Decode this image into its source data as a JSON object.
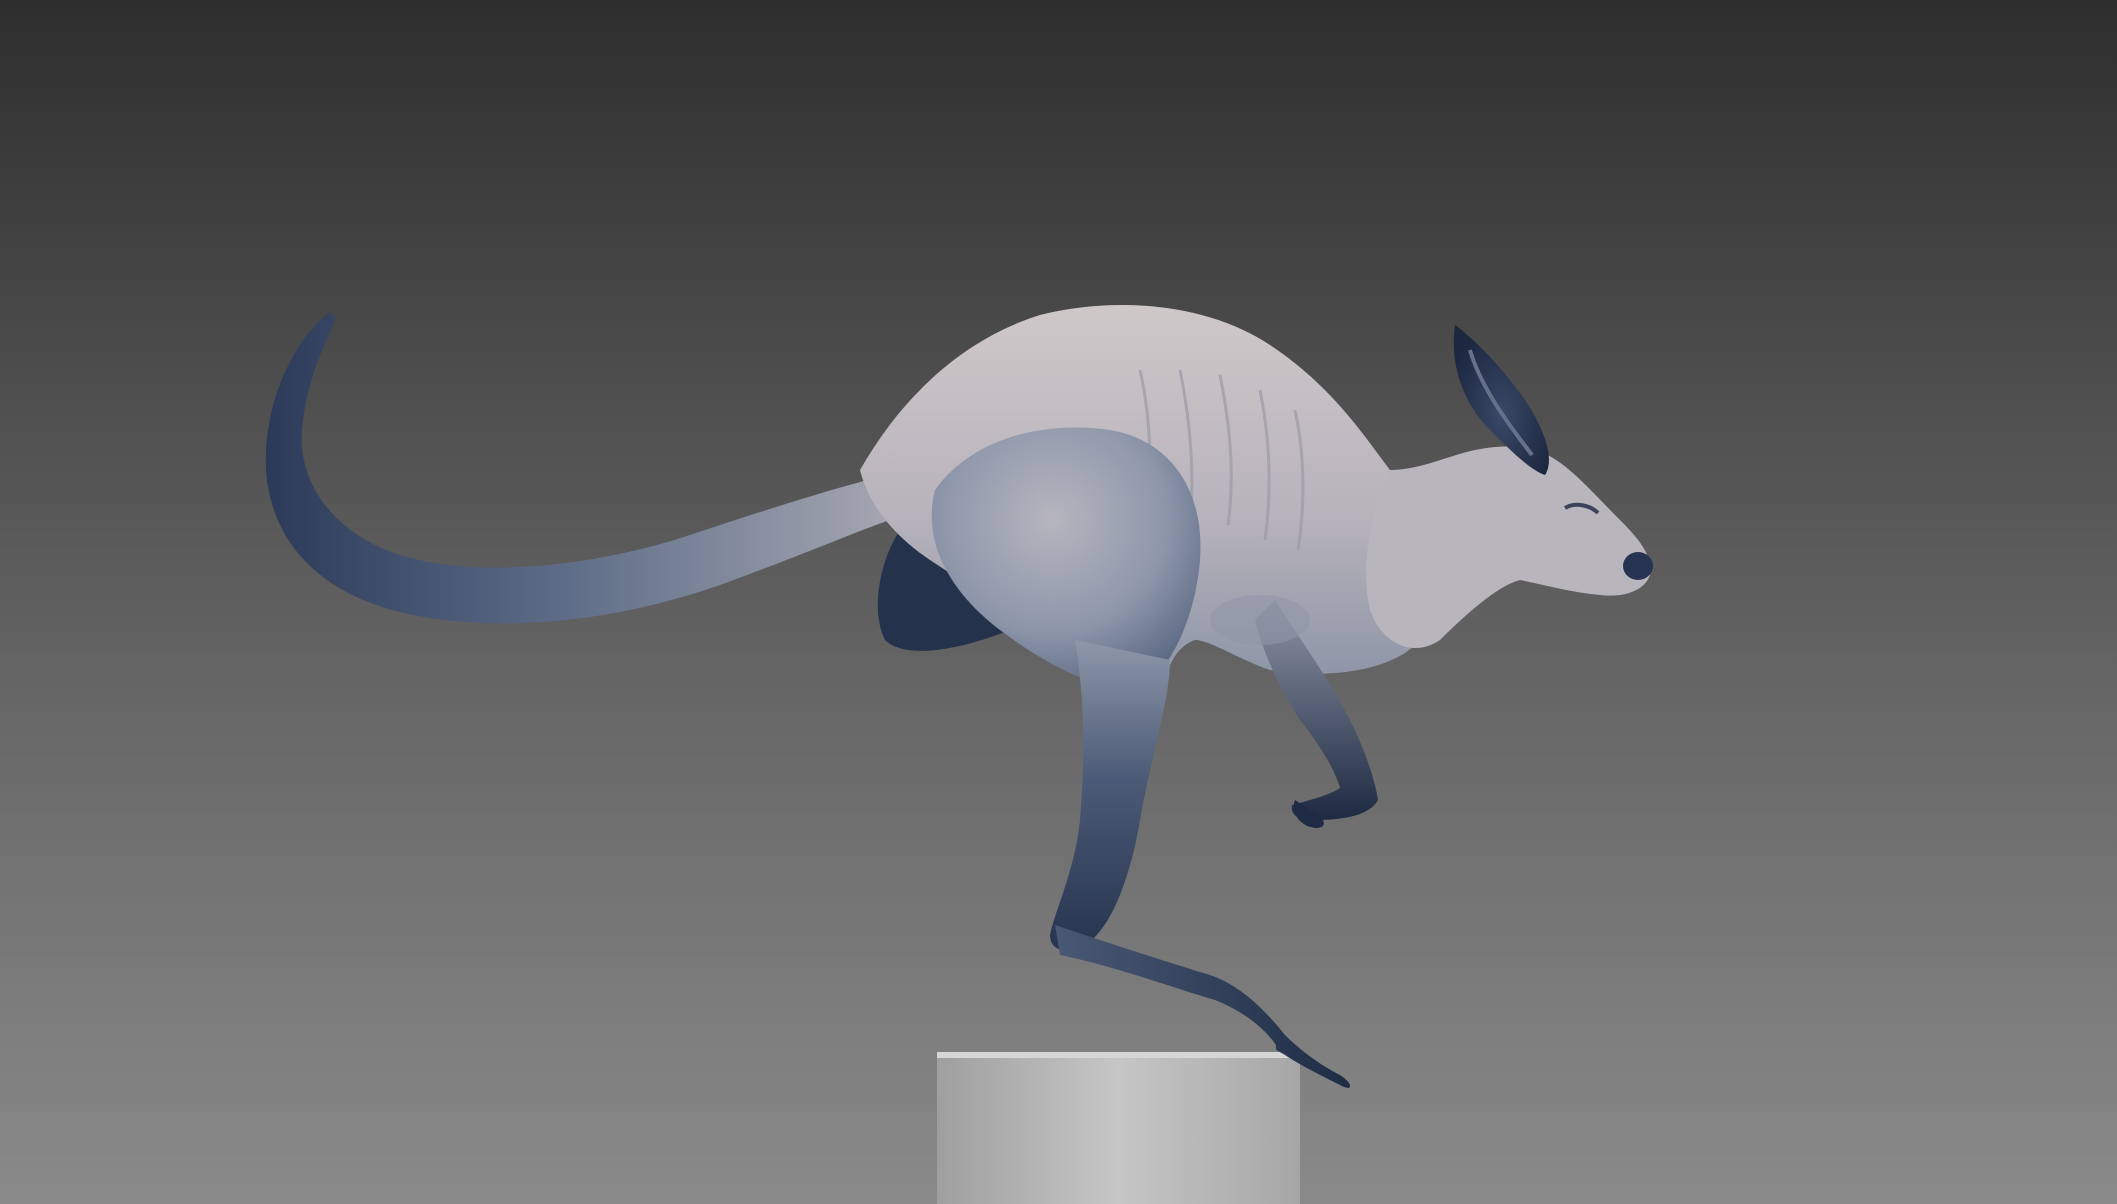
{
  "scene": {
    "subject": "kangaroo-sculpt",
    "background_top": "#2e2e2e",
    "background_bottom": "#8a8a8a",
    "body_light": "#c9c3c6",
    "body_mid": "#9aa2b2",
    "body_dark": "#2b3a55",
    "pedestal_light": "#c4c4c4",
    "pedestal_dark": "#9a9a9a"
  }
}
